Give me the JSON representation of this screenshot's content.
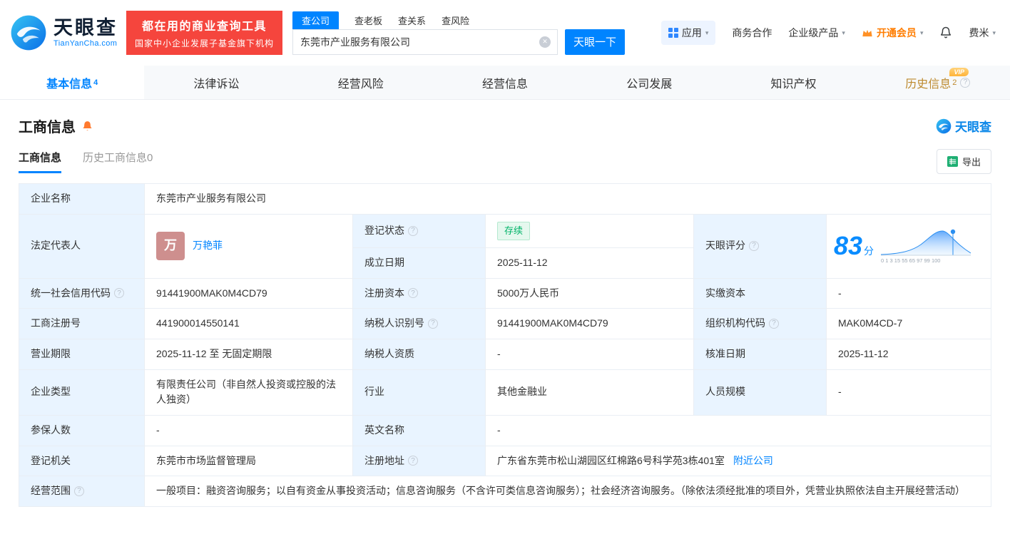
{
  "icons": {
    "caret": "▾",
    "clear": "✕",
    "help": "?"
  },
  "header": {
    "logo": {
      "brand": "天眼查",
      "domain": "TianYanCha.com"
    },
    "banner": {
      "line1": "都在用的商业查询工具",
      "line2": "国家中小企业发展子基金旗下机构"
    },
    "search": {
      "tabs": [
        {
          "label": "查公司"
        },
        {
          "label": "查老板"
        },
        {
          "label": "查关系"
        },
        {
          "label": "查风险"
        }
      ],
      "value": "东莞市产业服务有限公司",
      "button": "天眼一下"
    },
    "nav": {
      "apps": "应用",
      "cooperation": "商务合作",
      "enterprise": "企业级产品",
      "vip": "开通会员",
      "user": "费米"
    }
  },
  "tabs": [
    {
      "label": "基本信息",
      "count": "4"
    },
    {
      "label": "法律诉讼"
    },
    {
      "label": "经营风险"
    },
    {
      "label": "经营信息"
    },
    {
      "label": "公司发展"
    },
    {
      "label": "知识产权"
    },
    {
      "label": "历史信息",
      "count": "2",
      "vip": "VIP"
    }
  ],
  "section": {
    "title": "工商信息",
    "brand": "天眼查",
    "subtabs": [
      {
        "label": "工商信息"
      },
      {
        "label": "历史工商信息0"
      }
    ],
    "export_label": "导出"
  },
  "info": {
    "company_name": {
      "label": "企业名称",
      "value": "东莞市产业服务有限公司"
    },
    "legal_rep": {
      "label": "法定代表人",
      "avatar": "万",
      "name": "万艳菲"
    },
    "reg_status": {
      "label": "登记状态",
      "value": "存续"
    },
    "established": {
      "label": "成立日期",
      "value": "2025-11-12"
    },
    "score": {
      "label": "天眼评分",
      "value": "83",
      "unit": "分"
    },
    "credit_code": {
      "label": "统一社会信用代码",
      "value": "91441900MAK0M4CD79"
    },
    "reg_capital": {
      "label": "注册资本",
      "value": "5000万人民币"
    },
    "paid_capital": {
      "label": "实缴资本",
      "value": "-"
    },
    "reg_number": {
      "label": "工商注册号",
      "value": "441900014550141"
    },
    "taxpayer_id": {
      "label": "纳税人识别号",
      "value": "91441900MAK0M4CD79"
    },
    "org_code": {
      "label": "组织机构代码",
      "value": "MAK0M4CD-7"
    },
    "business_term": {
      "label": "营业期限",
      "value": "2025-11-12 至 无固定期限"
    },
    "taxpayer_quality": {
      "label": "纳税人资质",
      "value": "-"
    },
    "approval_date": {
      "label": "核准日期",
      "value": "2025-11-12"
    },
    "company_type": {
      "label": "企业类型",
      "value": "有限责任公司（非自然人投资或控股的法人独资）"
    },
    "industry": {
      "label": "行业",
      "value": "其他金融业"
    },
    "staff_size": {
      "label": "人员规模",
      "value": "-"
    },
    "insured_count": {
      "label": "参保人数",
      "value": "-"
    },
    "english_name": {
      "label": "英文名称",
      "value": "-"
    },
    "reg_authority": {
      "label": "登记机关",
      "value": "东莞市市场监督管理局"
    },
    "reg_address": {
      "label": "注册地址",
      "value": "广东省东莞市松山湖园区红棉路6号科学苑3栋401室",
      "link": "附近公司"
    },
    "business_scope": {
      "label": "经营范围",
      "value": "一般项目：融资咨询服务；以自有资金从事投资活动；信息咨询服务（不含许可类信息咨询服务）；社会经济咨询服务。（除依法须经批准的项目外，凭营业执照依法自主开展经营活动）"
    }
  },
  "chart_data": {
    "type": "area",
    "title": "天眼评分",
    "score": 83,
    "ticks": "0 1 3 15 55 65 97 99 100"
  }
}
